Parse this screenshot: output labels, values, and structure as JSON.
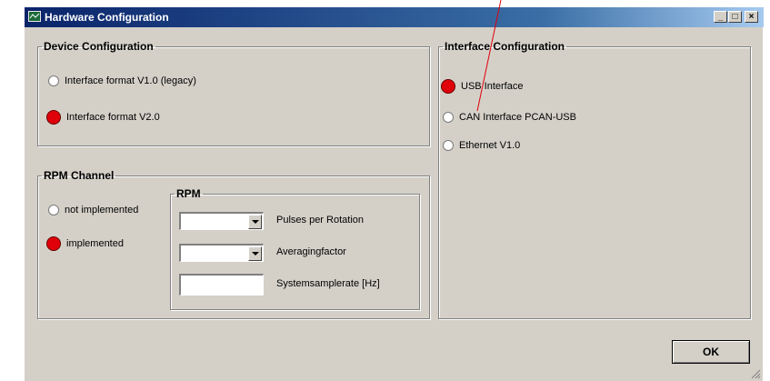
{
  "window": {
    "title": "Hardware Configuration",
    "buttons": {
      "minimize": "_",
      "maximize": "□",
      "close": "×"
    }
  },
  "device_config": {
    "legend": "Device Configuration",
    "options": [
      {
        "label": "Interface format V1.0 (legacy)",
        "selected": false
      },
      {
        "label": "Interface format V2.0",
        "selected": true
      }
    ]
  },
  "rpm_channel": {
    "legend": "RPM Channel",
    "options": [
      {
        "label": "not implemented",
        "selected": false
      },
      {
        "label": "implemented",
        "selected": true
      }
    ],
    "rpm": {
      "legend": "RPM",
      "pulses_label": "Pulses per Rotation",
      "averaging_label": "Averagingfactor",
      "samplerate_label": "Systemsamplerate [Hz]"
    }
  },
  "interface_config": {
    "legend": "Interface Configuration",
    "options": [
      {
        "label": "USB Interface",
        "selected": true
      },
      {
        "label": "CAN Interface PCAN-USB",
        "selected": false
      },
      {
        "label": "Ethernet V1.0",
        "selected": false
      }
    ]
  },
  "ok_label": "OK",
  "colors": {
    "selected_radio": "#e0000a",
    "annotation_line": "#e0000a",
    "dialog_bg": "#d4d0c8"
  }
}
